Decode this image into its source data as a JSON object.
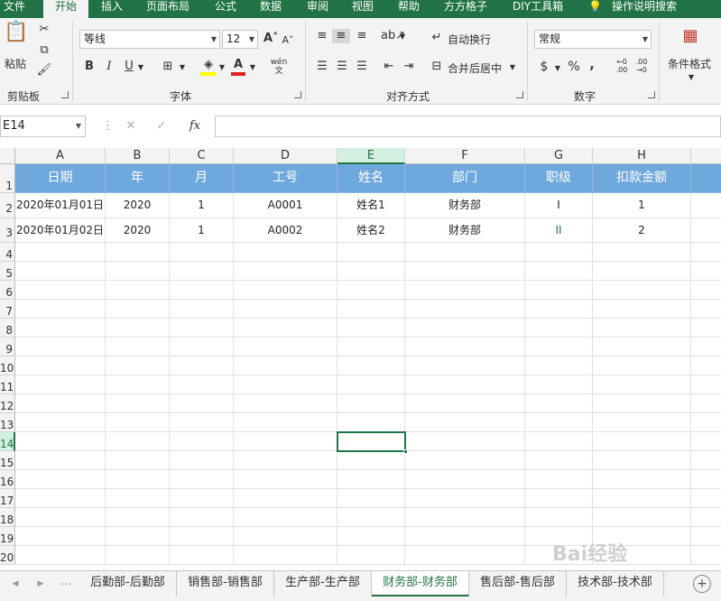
{
  "menu": [
    "文件",
    "开始",
    "插入",
    "页面布局",
    "公式",
    "数据",
    "审阅",
    "视图",
    "帮助",
    "方方格子",
    "DIY工具箱",
    "操作说明搜索"
  ],
  "ribbon": {
    "clipboard": {
      "paste": "粘贴",
      "label": "剪贴板"
    },
    "font": {
      "name": "等线",
      "size": "12",
      "bold": "B",
      "italic": "I",
      "underline": "U",
      "label": "字体",
      "phonetic": "wén"
    },
    "align": {
      "wrap": "自动换行",
      "merge": "合并后居中",
      "label": "对齐方式"
    },
    "number": {
      "format": "常规",
      "currency": "$",
      "percent": "%",
      "comma": ",",
      "label": "数字"
    },
    "styles": {
      "conditional": "条件格式"
    }
  },
  "formula": {
    "namebox": "E14",
    "fx": "fx"
  },
  "grid": {
    "columns": [
      "A",
      "B",
      "C",
      "D",
      "E",
      "F",
      "G",
      "H"
    ],
    "rows": [
      "1",
      "2",
      "3",
      "4",
      "5",
      "6",
      "7",
      "8",
      "9",
      "10",
      "11",
      "12",
      "13",
      "14",
      "15",
      "16",
      "17",
      "18",
      "19",
      "20"
    ],
    "header": [
      "日期",
      "年",
      "月",
      "工号",
      "姓名",
      "部门",
      "职级",
      "扣款金额"
    ],
    "data": [
      [
        "2020年01月01日",
        "2020",
        "1",
        "A0001",
        "姓名1",
        "财务部",
        "I",
        "1"
      ],
      [
        "2020年01月02日",
        "2020",
        "1",
        "A0002",
        "姓名2",
        "财务部",
        "II",
        "2"
      ]
    ],
    "selected_column": "E",
    "selected_row": "14"
  },
  "tabs": [
    "后勤部-后勤部",
    "销售部-销售部",
    "生产部-生产部",
    "财务部-财务部",
    "售后部-售后部",
    "技术部-技术部"
  ],
  "active_tab": "财务部-财务部",
  "watermark": "Bai经验",
  "colors": {
    "accent": "#217346",
    "header_fill": "#6fa8dc"
  }
}
